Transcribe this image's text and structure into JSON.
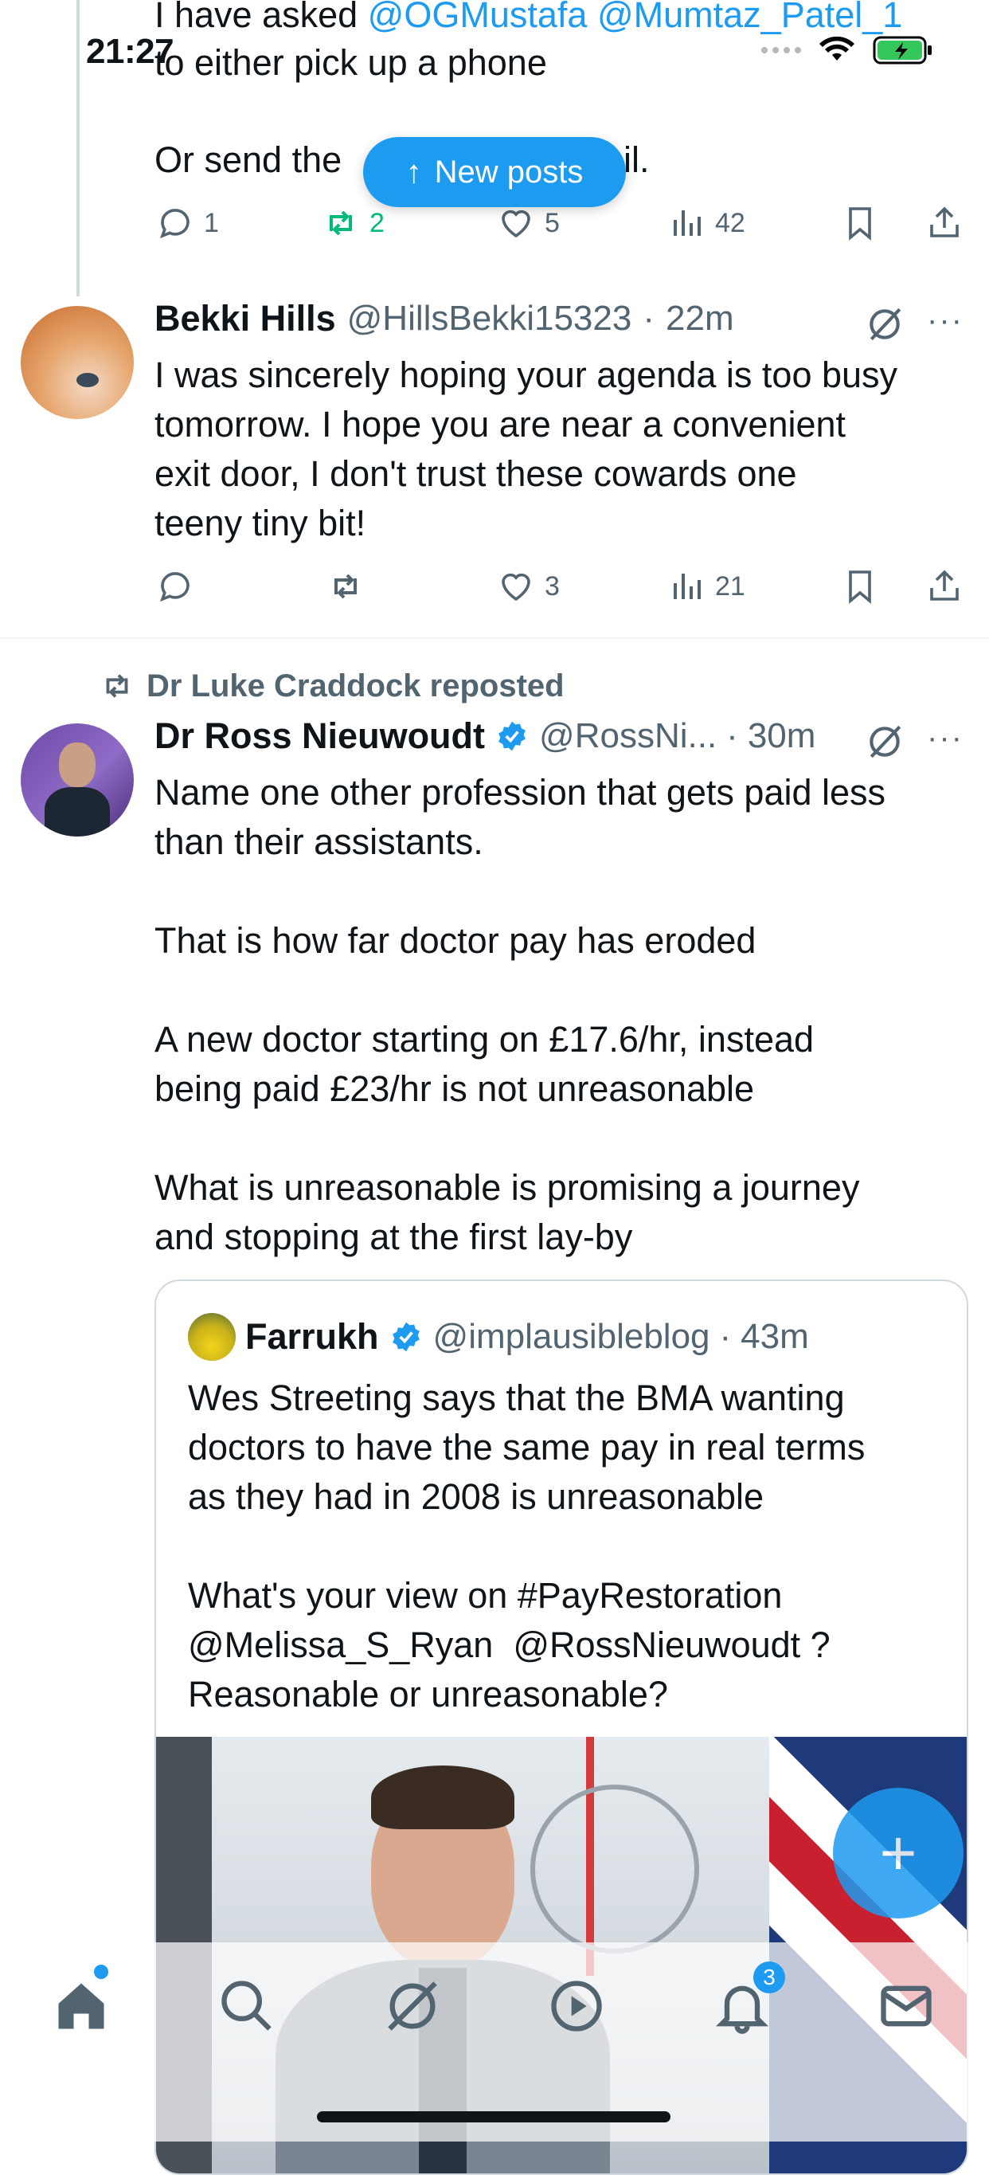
{
  "status": {
    "time": "21:27"
  },
  "new_posts": {
    "label": "New posts"
  },
  "tweet1": {
    "line1_prefix": "I have asked ",
    "mention1": "@OGMustafa",
    "mention2": "@Mumtaz_Patel_1",
    "line2": "to either pick up a phone",
    "line3_a": "Or send the",
    "line3_b": "ail.",
    "replies": "1",
    "reposts": "2",
    "likes": "5",
    "views": "42"
  },
  "tweet2": {
    "name": "Bekki Hills",
    "handle": "@HillsBekki15323",
    "dot": "·",
    "time": "22m",
    "text": "I was sincerely hoping your agenda is too busy\ntomorrow. I hope you are near a convenient\nexit door, I don't trust these cowards one\nteeny tiny bit!",
    "likes": "3",
    "views": "21"
  },
  "tweet3": {
    "repost_label": "Dr Luke Craddock reposted",
    "name": "Dr Ross Nieuwoudt",
    "handle": "@RossNi...",
    "dot": "·",
    "time": "30m",
    "text": "Name one other profession that gets paid less\nthan their assistants.\n\nThat is how far doctor pay has eroded\n\nA new doctor starting on £17.6/hr, instead\nbeing paid £23/hr is not unreasonable\n\nWhat is unreasonable is promising a journey\nand stopping at the first lay-by",
    "quote": {
      "name": "Farrukh",
      "handle": "@implausibleblog",
      "dot": "·",
      "time": "43m",
      "text": "Wes Streeting says that the BMA wanting\ndoctors to have the same pay in real terms\nas they had in 2008 is unreasonable\n\nWhat's your view on #PayRestoration\n@Melissa_S_Ryan  @RossNieuwoudt ?\nReasonable or unreasonable?"
    }
  },
  "fab": {
    "label": "+"
  },
  "tabbar": {
    "notifications_count": "3"
  },
  "colors": {
    "accent": "#1d9bf0",
    "repost_green": "#00ba7c",
    "muted": "#536471"
  },
  "icons": [
    "home-icon",
    "search-icon",
    "grok-icon",
    "play-icon",
    "bell-icon",
    "mail-icon"
  ]
}
